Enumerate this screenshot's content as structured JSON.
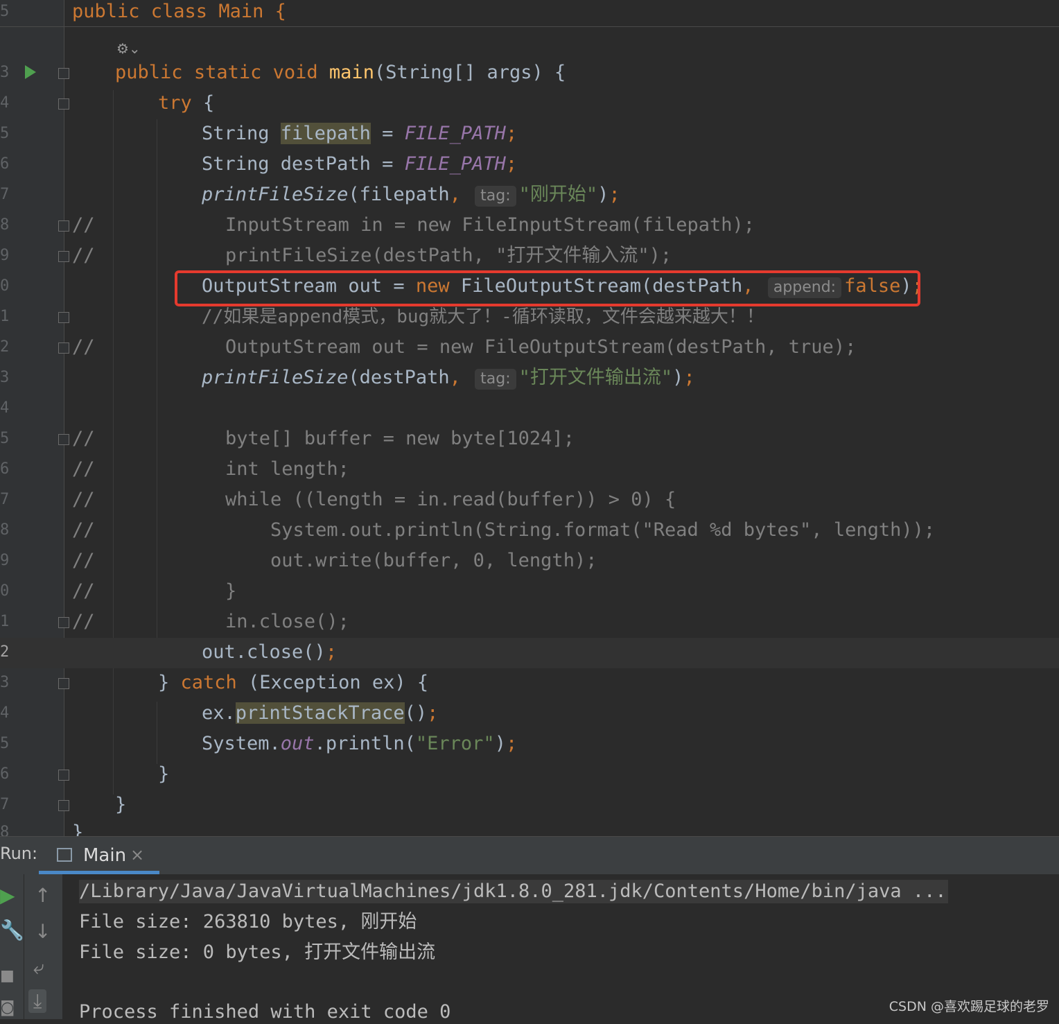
{
  "editor": {
    "lines": {
      "l15": {
        "num": "5",
        "code": "public class Main {"
      },
      "l23": {
        "num": "3",
        "kw1": "public",
        "kw2": "static",
        "kw3": "void",
        "fn": "main",
        "rest": "(String[] args) {"
      },
      "l24": {
        "num": "4",
        "kw": "try",
        "rest": " {"
      },
      "l25": {
        "num": "5",
        "a": "String ",
        "hl": "filepath",
        "b": " = ",
        "cst": "FILE_PATH",
        "semi": ";"
      },
      "l26": {
        "num": "6",
        "a": "String destPath = ",
        "cst": "FILE_PATH",
        "semi": ";"
      },
      "l27": {
        "num": "7",
        "fn": "printFileSize",
        "a": "(filepath",
        "comma": ",",
        "hint": "tag:",
        "str": "\"刚开始\"",
        "b": ")",
        "semi": ";"
      },
      "l28": {
        "num": "8",
        "cm1": "//",
        "cm2": "  InputStream in = new FileInputStream(filepath);"
      },
      "l29": {
        "num": "9",
        "cm1": "//",
        "cm2": "  printFileSize(destPath, \"打开文件输入流\");"
      },
      "l30": {
        "num": "0",
        "a": "OutputStream out = ",
        "kw": "new",
        "b": " FileOutputStream(destPath",
        "comma": ",",
        "hint": "append:",
        "kw2": "false",
        "c": ")",
        "semi": ";"
      },
      "l31": {
        "num": "1",
        "cm": "//如果是append模式，bug就大了！-循环读取，文件会越来越大！！"
      },
      "l32": {
        "num": "2",
        "cm1": "//",
        "cm2": "  OutputStream out = new FileOutputStream(destPath, true);"
      },
      "l33": {
        "num": "3",
        "fn": "printFileSize",
        "a": "(destPath",
        "comma": ",",
        "hint": "tag:",
        "str": "\"打开文件输出流\"",
        "b": ")",
        "semi": ";"
      },
      "l34": {
        "num": "4"
      },
      "l35": {
        "num": "5",
        "cm1": "//",
        "cm2": "  byte[] buffer = new byte[1024];"
      },
      "l36": {
        "num": "6",
        "cm1": "//",
        "cm2": "  int length;"
      },
      "l37": {
        "num": "7",
        "cm1": "//",
        "cm2": "  while ((length = in.read(buffer)) > 0) {"
      },
      "l38": {
        "num": "8",
        "cm1": "//",
        "cm2": "      System.out.println(String.format(\"Read %d bytes\", length));"
      },
      "l39": {
        "num": "9",
        "cm1": "//",
        "cm2": "      out.write(buffer, 0, length);"
      },
      "l40": {
        "num": "0",
        "cm1": "//",
        "cm2": "  }"
      },
      "l41": {
        "num": "1",
        "cm1": "//",
        "cm2": "  in.close();"
      },
      "l42": {
        "num": "2",
        "a": "out.close()",
        "semi": ";"
      },
      "l43": {
        "num": "3",
        "a": "} ",
        "kw": "catch",
        "b": " (Exception ex) {"
      },
      "l44": {
        "num": "4",
        "a": "ex.",
        "hl": "printStackTrace",
        "b": "()",
        "semi": ";"
      },
      "l45": {
        "num": "5",
        "a": "System.",
        "cst": "out",
        "b": ".println(",
        "str": "\"Error\"",
        "c": ")",
        "semi": ";"
      },
      "l46": {
        "num": "6",
        "a": "}"
      },
      "l47": {
        "num": "7",
        "a": "}"
      },
      "l48": {
        "num": "8",
        "a": "}"
      }
    }
  },
  "run": {
    "label": "Run:",
    "tab": {
      "label": "Main",
      "close": "×"
    },
    "console": {
      "cmd": "/Library/Java/JavaVirtualMachines/jdk1.8.0_281.jdk/Contents/Home/bin/java ...",
      "out1": "File size: 263810 bytes, 刚开始",
      "out2": "File size: 0 bytes, 打开文件输出流",
      "out3": "Process finished with exit code 0"
    }
  },
  "watermark": "CSDN @喜欢踢足球的老罗",
  "colors": {
    "keyword": "#cc7832",
    "function": "#ffc66d",
    "constant": "#9876aa",
    "string": "#6a8759",
    "comment": "#808080",
    "highlight_box": "#e53a2e"
  }
}
